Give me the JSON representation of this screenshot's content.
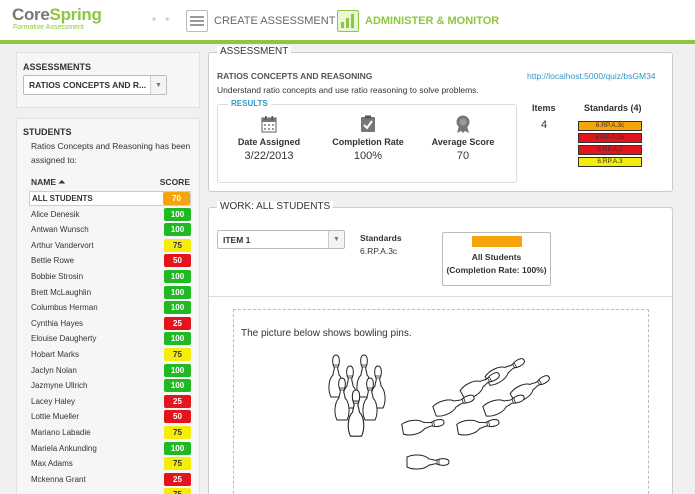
{
  "header": {
    "logo_main": "Core",
    "logo_brand": "Spring",
    "logo_sub": "Formative Assessment",
    "nav_create": "CREATE ASSESSMENT",
    "nav_admin": "ADMINISTER & MONITOR"
  },
  "left": {
    "assessments_title": "ASSESSMENTS",
    "assessment_selected": "RATIOS CONCEPTS AND R...",
    "students_title": "STUDENTS",
    "students_desc": "Ratios Concepts and Reasoning has been assigned to:",
    "col_name": "NAME",
    "col_score": "SCORE",
    "students": [
      {
        "name": "ALL STUDENTS",
        "score": "70",
        "color": "orange"
      },
      {
        "name": "Alice Denesik",
        "score": "100",
        "color": "green"
      },
      {
        "name": "Antwan Wunsch",
        "score": "100",
        "color": "green"
      },
      {
        "name": "Arthur Vandervort",
        "score": "75",
        "color": "yellow"
      },
      {
        "name": "Bettie Rowe",
        "score": "50",
        "color": "red"
      },
      {
        "name": "Bobbie Strosin",
        "score": "100",
        "color": "green"
      },
      {
        "name": "Brett McLaughlin",
        "score": "100",
        "color": "green"
      },
      {
        "name": "Columbus Herman",
        "score": "100",
        "color": "green"
      },
      {
        "name": "Cynthia Hayes",
        "score": "25",
        "color": "red"
      },
      {
        "name": "Elouise Daugherty",
        "score": "100",
        "color": "green"
      },
      {
        "name": "Hobart Marks",
        "score": "75",
        "color": "yellow"
      },
      {
        "name": "Jaclyn Nolan",
        "score": "100",
        "color": "green"
      },
      {
        "name": "Jazmyne Ullrich",
        "score": "100",
        "color": "green"
      },
      {
        "name": "Lacey Haley",
        "score": "25",
        "color": "red"
      },
      {
        "name": "Lottie Mueller",
        "score": "50",
        "color": "red"
      },
      {
        "name": "Mariano Labadie",
        "score": "75",
        "color": "yellow"
      },
      {
        "name": "Mariela Ankunding",
        "score": "100",
        "color": "green"
      },
      {
        "name": "Max Adams",
        "score": "75",
        "color": "yellow"
      },
      {
        "name": "Mckenna Grant",
        "score": "25",
        "color": "red"
      },
      {
        "name": "",
        "score": "75",
        "color": "yellow"
      }
    ]
  },
  "assessment": {
    "legend": "ASSESSMENT",
    "title": "RATIOS CONCEPTS AND REASONING",
    "description": "Understand ratio concepts and use ratio reasoning to solve problems.",
    "link": "http://localhost:5000/quiz/bsGM34",
    "results_legend": "RESULTS",
    "date_label": "Date Assigned",
    "date_value": "3/22/2013",
    "completion_label": "Completion Rate",
    "completion_value": "100%",
    "avg_label": "Average Score",
    "avg_value": "70",
    "items_label": "Items",
    "items_value": "4",
    "standards_label": "Standards (4)",
    "standards": [
      {
        "code": "6.RP.A.3c",
        "color": "#f5a50a"
      },
      {
        "code": "6.RP.A.3b",
        "color": "#e3141b"
      },
      {
        "code": "6.RP.A.2",
        "color": "#e3141b"
      },
      {
        "code": "6.RP.A.3",
        "color": "#f5ec0a"
      }
    ]
  },
  "work": {
    "legend": "WORK:  ALL STUDENTS",
    "item_selected": "ITEM 1",
    "standards_label": "Standards",
    "standards_value": "6.RP.A.3c",
    "all_students_label": "All Students",
    "completion_text": "(Completion Rate: 100%)",
    "question_text": "The picture below shows bowling pins."
  }
}
